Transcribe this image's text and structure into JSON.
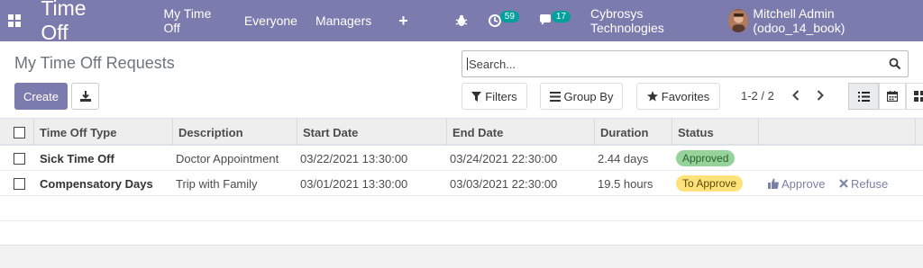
{
  "navbar": {
    "app_title": "Time Off",
    "menu": [
      "My Time Off",
      "Everyone",
      "Managers"
    ],
    "plus_symbol": "+",
    "activity_count": "59",
    "message_count": "17",
    "company": "Cybrosys Technologies",
    "user": "Mitchell Admin (odoo_14_book)",
    "color": "#7c7bad"
  },
  "control_panel": {
    "title": "My Time Off Requests",
    "search_placeholder": "Search...",
    "create_label": "Create",
    "filters_label": "Filters",
    "groupby_label": "Group By",
    "favorites_label": "Favorites",
    "pager": "1-2 / 2"
  },
  "table": {
    "headers": [
      "Time Off Type",
      "Description",
      "Start Date",
      "End Date",
      "Duration",
      "Status"
    ],
    "rows": [
      {
        "type": "Sick Time Off",
        "description": "Doctor Appointment",
        "start": "03/22/2021 13:30:00",
        "end": "03/24/2021 22:30:00",
        "duration": "2.44 days",
        "status": "Approved",
        "status_color": "#96d39b"
      },
      {
        "type": "Compensatory Days",
        "description": "Trip with Family",
        "start": "03/01/2021 13:30:00",
        "end": "03/03/2021 22:30:00",
        "duration": "19.5 hours",
        "status": "To Approve",
        "status_color": "#ffe27a",
        "approve_label": "Approve",
        "refuse_label": "Refuse"
      }
    ]
  }
}
